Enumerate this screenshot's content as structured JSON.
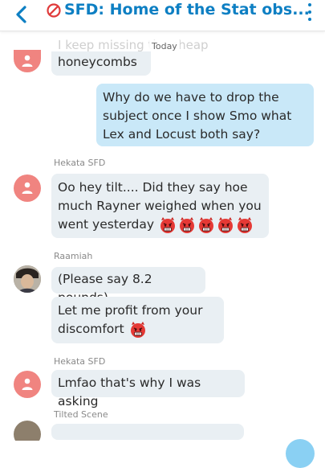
{
  "header": {
    "title": "SFD: Home of the Stat obs...",
    "accent": "#0d7fc3"
  },
  "chat": {
    "today_label": "Today",
    "ghost_text": "I keep missing the cheap",
    "messages": [
      {
        "id": "m1",
        "direction": "in",
        "sender": "",
        "text": "honeycombs"
      },
      {
        "id": "m2",
        "direction": "out",
        "lines": [
          "Why do we have to drop the",
          "subject once I show Smo what",
          "Lex and Locust both say?"
        ]
      },
      {
        "id": "m3",
        "direction": "in",
        "sender": "Hekata SFD",
        "lines": [
          "Oo hey tilt.... Did they say hoe",
          "much Rayner weighed when you",
          "went yesterday"
        ],
        "emoji_count": 5,
        "emoji": "imp-face"
      },
      {
        "id": "m4",
        "direction": "in",
        "sender": "Raamiah",
        "text": "(Please say 8.2 pounds)"
      },
      {
        "id": "m5",
        "direction": "in",
        "sender": "",
        "lines": [
          "Let me profit from your",
          "discomfort"
        ],
        "emoji_count": 1,
        "emoji": "imp-face"
      },
      {
        "id": "m6",
        "direction": "in",
        "sender": "Hekata SFD",
        "text": "Lmfao that's why I was asking"
      },
      {
        "id": "m7",
        "direction": "in",
        "sender": "Tilted Scene",
        "text": ""
      }
    ]
  },
  "colors": {
    "incoming_bubble": "#e9eff3",
    "outgoing_bubble": "#c9e8f8",
    "avatar_default": "#f08480"
  }
}
